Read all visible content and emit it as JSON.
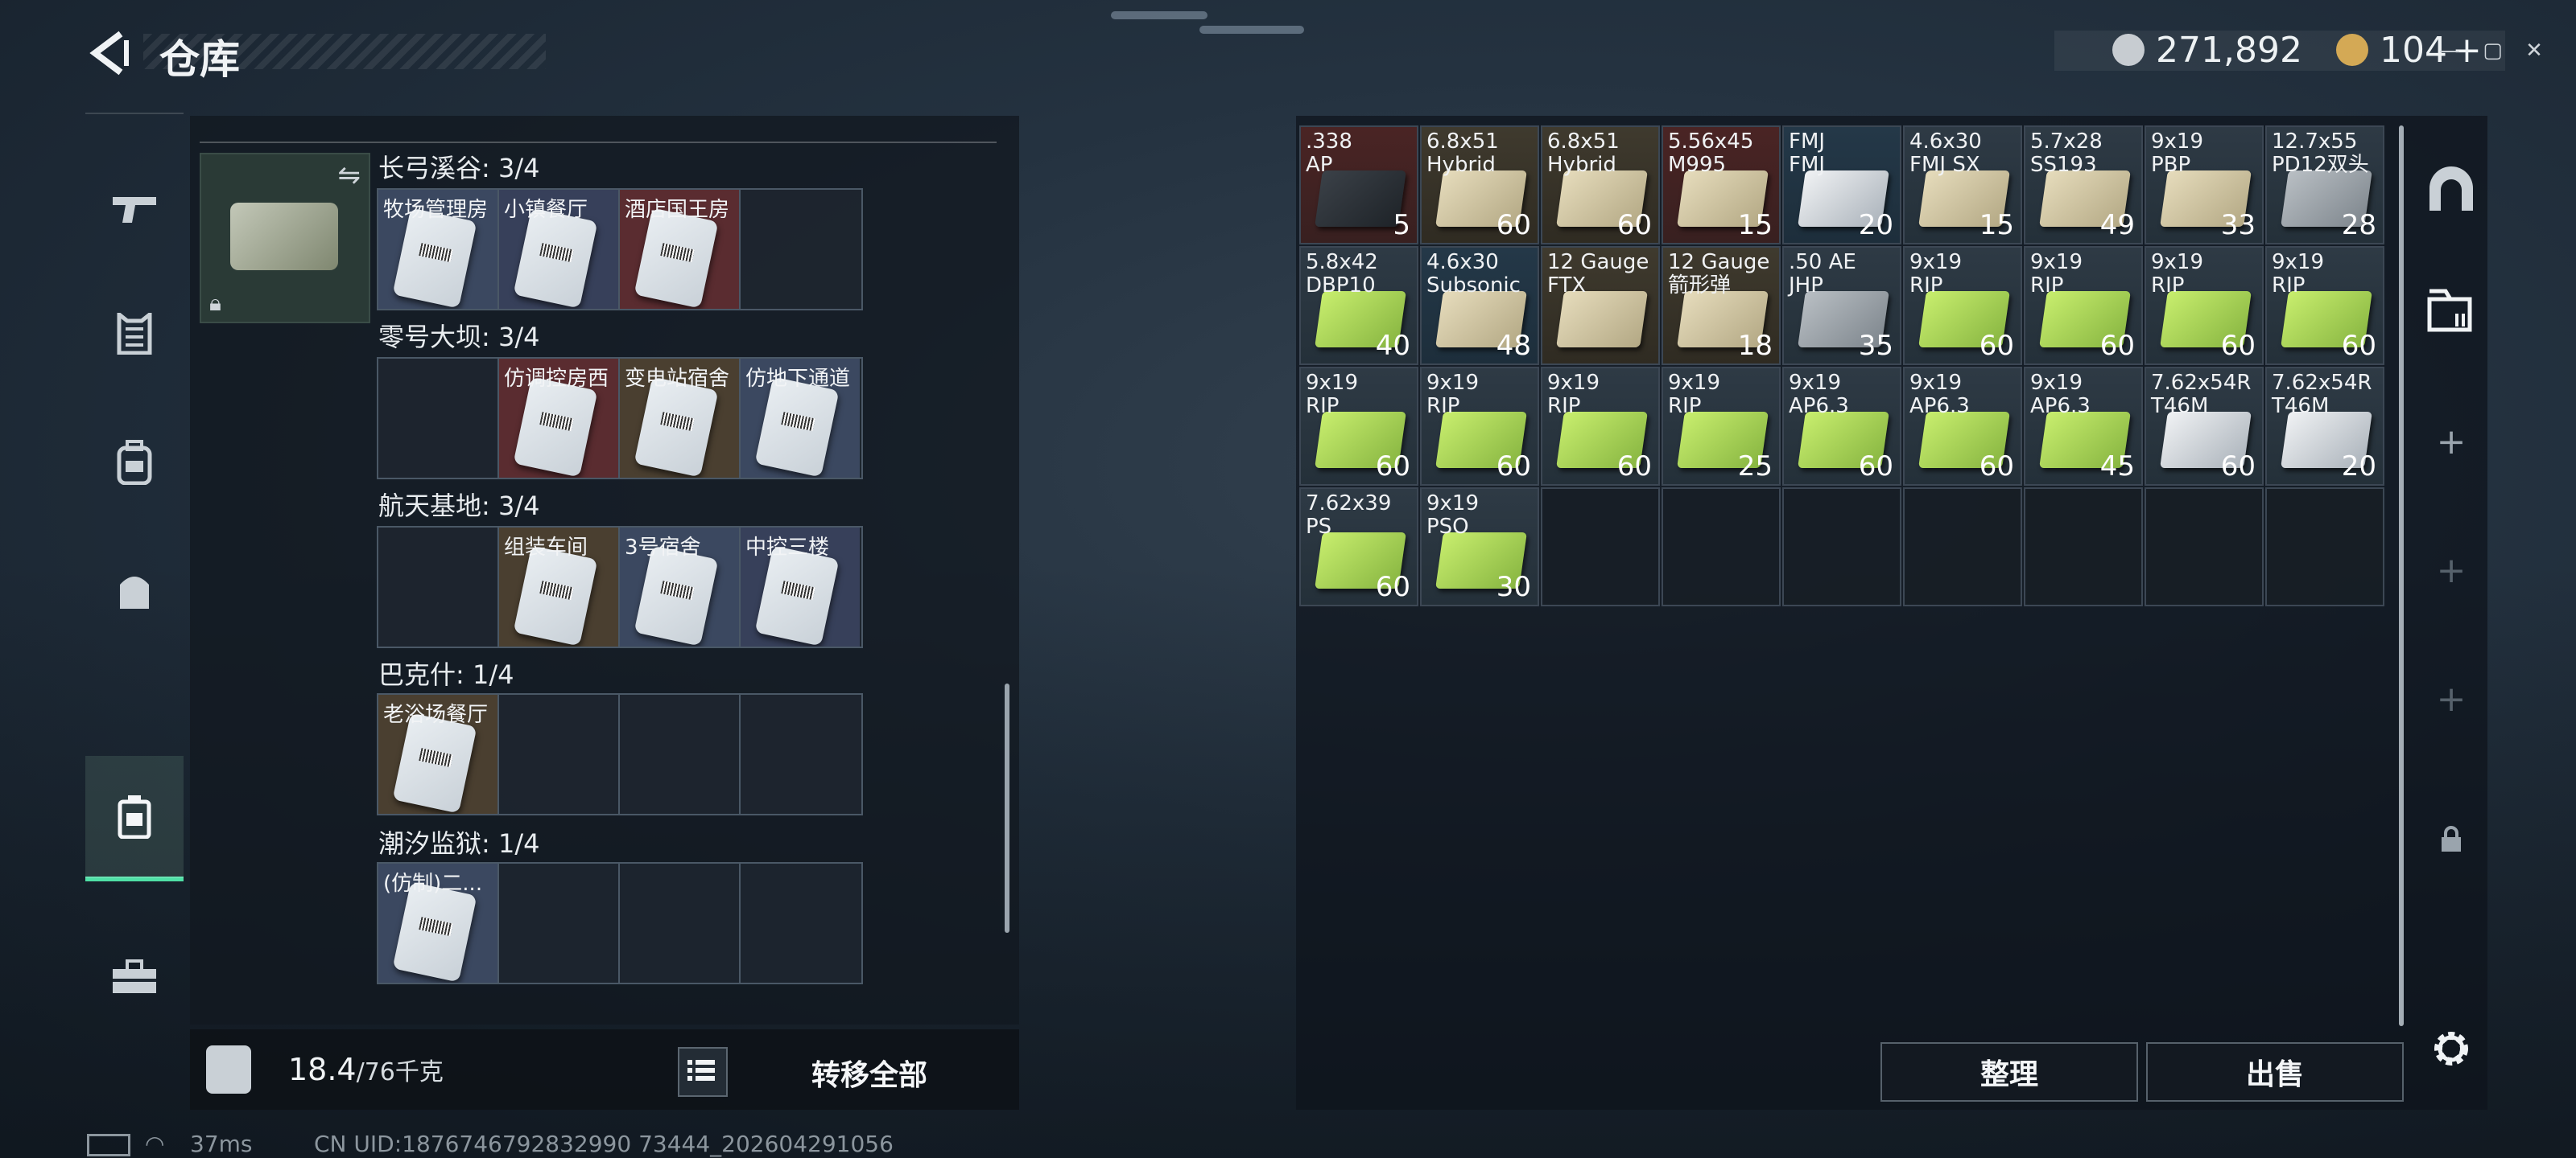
{
  "header": {
    "title": "仓库",
    "win_controls": "— ▢ ✕"
  },
  "currency": {
    "silver_amount": "271,892",
    "gold_amount": "104",
    "gold_add": "+",
    "silver_color": "#c7ccd1",
    "gold_color": "#d4a955"
  },
  "rail": {
    "items": [
      "weapon-icon",
      "armor-icon",
      "backpack-icon",
      "bag-icon",
      "storage-icon",
      "toolbox-icon"
    ],
    "active": "storage-icon"
  },
  "sections": [
    {
      "title": "长弓溪谷: 3/4",
      "slots": [
        "牧场管理房",
        "小镇餐厅",
        "酒店国王房",
        ""
      ]
    },
    {
      "title": "零号大坝: 3/4",
      "slots": [
        "",
        "仿调控房西",
        "变电站宿舍",
        "仿地下通道"
      ]
    },
    {
      "title": "航天基地: 3/4",
      "slots": [
        "",
        "组装车间",
        "3号宿舍",
        "中控三楼"
      ]
    },
    {
      "title": "巴克什: 1/4",
      "slots": [
        "老浴场餐厅",
        "",
        "",
        ""
      ]
    },
    {
      "title": "潮汐监狱: 1/4",
      "slots": [
        "(仿制)二...",
        "",
        "",
        ""
      ]
    }
  ],
  "footer": {
    "weight_current": "18.4",
    "weight_max": "/76千克",
    "transfer_label": "转移全部"
  },
  "status": {
    "ping": "37ms",
    "uid": "CN UID:1876746792832990 73444_202604291056"
  },
  "stash": {
    "cols": 9,
    "items": [
      {
        "name": ".338\nAP",
        "qty": "5",
        "style": "red",
        "box": "dark"
      },
      {
        "name": "6.8x51\nHybrid",
        "qty": "60",
        "style": "tan",
        "box": "cream"
      },
      {
        "name": "6.8x51\nHybrid",
        "qty": "60",
        "style": "tan",
        "box": "cream"
      },
      {
        "name": "5.56x45\nM995",
        "qty": "15",
        "style": "red",
        "box": "cream"
      },
      {
        "name": "FMJ\nFMJ",
        "qty": "20",
        "style": "blue",
        "box": "white"
      },
      {
        "name": "4.6x30\nFMJ SX",
        "qty": "15",
        "style": "filled",
        "box": "cream"
      },
      {
        "name": "5.7x28\nSS193",
        "qty": "49",
        "style": "filled",
        "box": "cream"
      },
      {
        "name": "9x19\nPBP",
        "qty": "33",
        "style": "filled",
        "box": "cream"
      },
      {
        "name": "12.7x55\nPD12双头",
        "qty": "28",
        "style": "filled",
        "box": "gray"
      },
      {
        "name": "5.8x42\nDBP10",
        "qty": "40",
        "style": "filled",
        "box": "green"
      },
      {
        "name": "4.6x30\nSubsonic",
        "qty": "48",
        "style": "blue",
        "box": "cream"
      },
      {
        "name": "12 Gauge\nFTX",
        "qty": "",
        "style": "tan",
        "box": "cream"
      },
      {
        "name": "12 Gauge\n箭形弹",
        "qty": "18",
        "style": "tan",
        "box": "cream"
      },
      {
        "name": ".50 AE\nJHP",
        "qty": "35",
        "style": "filled",
        "box": "gray"
      },
      {
        "name": "9x19\nRIP",
        "qty": "60",
        "style": "filled",
        "box": "green"
      },
      {
        "name": "9x19\nRIP",
        "qty": "60",
        "style": "filled",
        "box": "green"
      },
      {
        "name": "9x19\nRIP",
        "qty": "60",
        "style": "filled",
        "box": "green"
      },
      {
        "name": "9x19\nRIP",
        "qty": "60",
        "style": "filled",
        "box": "green"
      },
      {
        "name": "9x19\nRIP",
        "qty": "60",
        "style": "filled",
        "box": "green"
      },
      {
        "name": "9x19\nRIP",
        "qty": "60",
        "style": "filled",
        "box": "green"
      },
      {
        "name": "9x19\nRIP",
        "qty": "60",
        "style": "filled",
        "box": "green"
      },
      {
        "name": "9x19\nRIP",
        "qty": "25",
        "style": "filled",
        "box": "green"
      },
      {
        "name": "9x19\nAP6.3",
        "qty": "60",
        "style": "filled",
        "box": "green"
      },
      {
        "name": "9x19\nAP6.3",
        "qty": "60",
        "style": "filled",
        "box": "green"
      },
      {
        "name": "9x19\nAP6.3",
        "qty": "45",
        "style": "filled",
        "box": "green"
      },
      {
        "name": "7.62x54R\nT46M",
        "qty": "60",
        "style": "filled",
        "box": "white"
      },
      {
        "name": "7.62x54R\nT46M",
        "qty": "20",
        "style": "filled",
        "box": "white"
      },
      {
        "name": "7.62x39\nPS",
        "qty": "60",
        "style": "filled",
        "box": "green"
      },
      {
        "name": "9x19\nPSO",
        "qty": "30",
        "style": "filled",
        "box": "green"
      }
    ],
    "empty_after_count": 7
  },
  "actions": {
    "sort_label": "整理",
    "sell_label": "出售"
  }
}
